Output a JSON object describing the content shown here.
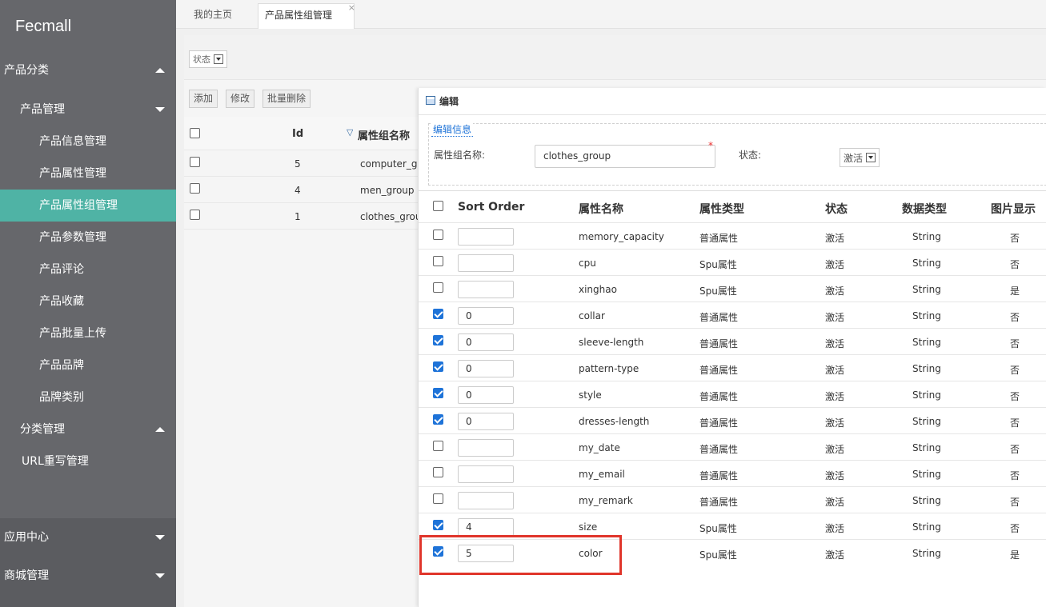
{
  "app": {
    "title": "Fecmall"
  },
  "sidebar": {
    "items": [
      {
        "label": "产品分类",
        "caret": "up"
      },
      {
        "label": "产品管理",
        "caret": "down"
      },
      {
        "label": "产品信息管理"
      },
      {
        "label": "产品属性管理"
      },
      {
        "label": "产品属性组管理",
        "active": true
      },
      {
        "label": "产品参数管理"
      },
      {
        "label": "产品评论"
      },
      {
        "label": "产品收藏"
      },
      {
        "label": "产品批量上传"
      },
      {
        "label": "产品品牌"
      },
      {
        "label": "品牌类别"
      },
      {
        "label": "分类管理",
        "caret": "up"
      },
      {
        "label": "URL重写管理"
      },
      {
        "label": "应用中心",
        "caret": "down"
      },
      {
        "label": "商城管理",
        "caret": "down"
      }
    ]
  },
  "tabs": [
    {
      "label": "我的主页"
    },
    {
      "label": "产品属性组管理",
      "active": true,
      "close": "×"
    }
  ],
  "filter": {
    "status_label": "状态"
  },
  "toolbar": {
    "add": "添加",
    "edit": "修改",
    "batch_delete": "批量删除"
  },
  "grid": {
    "headers": {
      "id": "Id",
      "name": "属性组名称",
      "sort_icon": "▽"
    },
    "rows": [
      {
        "id": "5",
        "name": "computer_group"
      },
      {
        "id": "4",
        "name": "men_group"
      },
      {
        "id": "1",
        "name": "clothes_group"
      }
    ]
  },
  "dialog": {
    "title": "编辑",
    "legend": "编辑信息",
    "name_label": "属性组名称:",
    "name_value": "clothes_group",
    "required_mark": "*",
    "status_label": "状态:",
    "status_value": "激活",
    "columns": {
      "sort": "Sort Order",
      "name": "属性名称",
      "type": "属性类型",
      "status": "状态",
      "data_type": "数据类型",
      "image": "图片显示"
    },
    "rows": [
      {
        "checked": false,
        "sort": "",
        "name": "memory_capacity",
        "type": "普通属性",
        "status": "激活",
        "data_type": "String",
        "image": "否"
      },
      {
        "checked": false,
        "sort": "",
        "name": "cpu",
        "type": "Spu属性",
        "status": "激活",
        "data_type": "String",
        "image": "否"
      },
      {
        "checked": false,
        "sort": "",
        "name": "xinghao",
        "type": "Spu属性",
        "status": "激活",
        "data_type": "String",
        "image": "是"
      },
      {
        "checked": true,
        "sort": "0",
        "name": "collar",
        "type": "普通属性",
        "status": "激活",
        "data_type": "String",
        "image": "否"
      },
      {
        "checked": true,
        "sort": "0",
        "name": "sleeve-length",
        "type": "普通属性",
        "status": "激活",
        "data_type": "String",
        "image": "否"
      },
      {
        "checked": true,
        "sort": "0",
        "name": "pattern-type",
        "type": "普通属性",
        "status": "激活",
        "data_type": "String",
        "image": "否"
      },
      {
        "checked": true,
        "sort": "0",
        "name": "style",
        "type": "普通属性",
        "status": "激活",
        "data_type": "String",
        "image": "否"
      },
      {
        "checked": true,
        "sort": "0",
        "name": "dresses-length",
        "type": "普通属性",
        "status": "激活",
        "data_type": "String",
        "image": "否"
      },
      {
        "checked": false,
        "sort": "",
        "name": "my_date",
        "type": "普通属性",
        "status": "激活",
        "data_type": "String",
        "image": "否"
      },
      {
        "checked": false,
        "sort": "",
        "name": "my_email",
        "type": "普通属性",
        "status": "激活",
        "data_type": "String",
        "image": "否"
      },
      {
        "checked": false,
        "sort": "",
        "name": "my_remark",
        "type": "普通属性",
        "status": "激活",
        "data_type": "String",
        "image": "否"
      },
      {
        "checked": true,
        "sort": "4",
        "name": "size",
        "type": "Spu属性",
        "status": "激活",
        "data_type": "String",
        "image": "否"
      },
      {
        "checked": true,
        "sort": "5",
        "name": "color",
        "type": "Spu属性",
        "status": "激活",
        "data_type": "String",
        "image": "是"
      }
    ]
  },
  "colors": {
    "sidebar_bg": "#66676b",
    "sidebar_active": "#4fb3a5",
    "checkbox_checked": "#1e73d8",
    "highlight": "#e0352b"
  }
}
